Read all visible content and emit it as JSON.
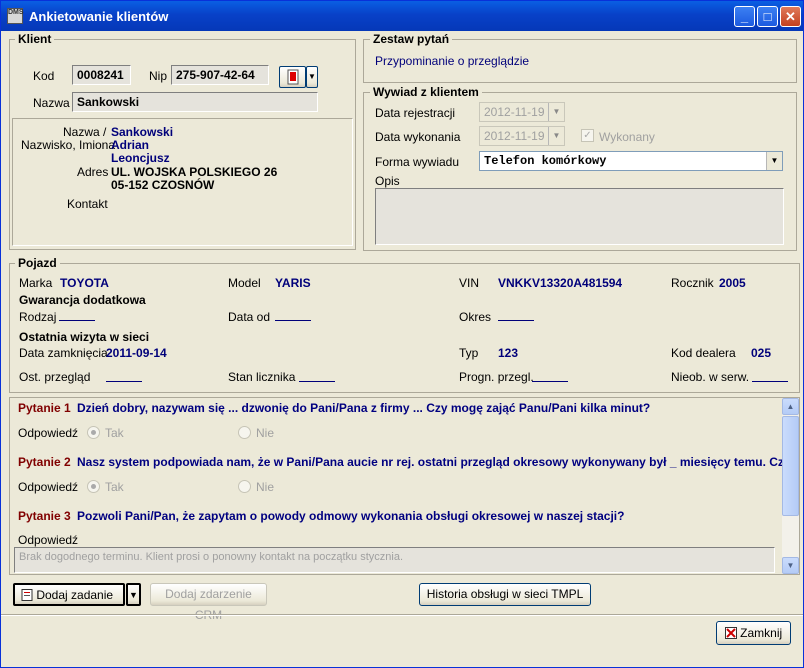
{
  "window": {
    "title": "Ankietowanie klientów",
    "app_icon": "app-badge",
    "min": "_",
    "max": "□",
    "close": "✕"
  },
  "klient": {
    "title": "Klient",
    "kod_label": "Kod",
    "kod_value": "0008241",
    "nip_label": "Nip",
    "nip_value": "275-907-42-64",
    "nazwa_label": "Nazwa",
    "nazwa_value": "Sankowski",
    "nazwa_nazwisko_label1": "Nazwa /",
    "nazwa_nazwisko_label2": "Nazwisko, Imiona",
    "nazwisko_value": "Sankowski",
    "imie1_value": "Adrian",
    "imie2_value": "Leoncjusz",
    "adres_label": "Adres",
    "adres_line1": "UL. WOJSKA POLSKIEGO 26",
    "adres_line2": "05-152 CZOSNÓW",
    "kontakt_label": "Kontakt"
  },
  "zestaw": {
    "title": "Zestaw pytań",
    "value": "Przypominanie o przeglądzie"
  },
  "wywiad": {
    "title": "Wywiad z klientem",
    "data_rej_label": "Data rejestracji",
    "data_rej_value": "2012-11-19",
    "data_wyk_label": "Data wykonania",
    "data_wyk_value": "2012-11-19",
    "wykonany_label": "Wykonany",
    "forma_label": "Forma wywiadu",
    "forma_value": "Telefon komórkowy",
    "opis_label": "Opis"
  },
  "pojazd": {
    "title": "Pojazd",
    "marka_label": "Marka",
    "marka_value": "TOYOTA",
    "model_label": "Model",
    "model_value": "YARIS",
    "vin_label": "VIN",
    "vin_value": "VNKKV13320A481594",
    "rocznik_label": "Rocznik",
    "rocznik_value": "2005",
    "gwarancja_title": "Gwarancja dodatkowa",
    "rodzaj_label": "Rodzaj",
    "data_od_label": "Data od",
    "okres_label": "Okres",
    "wizyta_title": "Ostatnia wizyta w sieci",
    "data_zamk_label": "Data zamknięcia",
    "data_zamk_value": "2011-09-14",
    "typ_label": "Typ",
    "typ_value": "123",
    "kod_dealera_label": "Kod dealera",
    "kod_dealera_value": "025",
    "ost_przeglad_label": "Ost. przegląd",
    "stan_licznika_label": "Stan licznika",
    "progn_label": "Progn. przegl.",
    "nieob_label": "Nieob. w serw."
  },
  "questions": [
    {
      "label": "Pytanie 1",
      "text": "Dzień dobry, nazywam się ... dzwonię do Pani/Pana z firmy ... Czy mogę zająć Panu/Pani kilka minut?",
      "answer_label": "Odpowiedź",
      "yes": "Tak",
      "no": "Nie"
    },
    {
      "label": "Pytanie 2",
      "text": "Nasz system podpowiada nam, że w Pani/Pana aucie nr rej. ostatni przegląd okresowy wykonywany był _ miesięcy temu. Czy",
      "answer_label": "Odpowiedź",
      "yes": "Tak",
      "no": "Nie"
    },
    {
      "label": "Pytanie 3",
      "text": "Pozwoli Pani/Pan, że zapytam o powody odmowy wykonania obsługi okresowej w naszej stacji?",
      "answer_label": "Odpowiedź",
      "answer_text": "Brak dogodnego terminu. Klient prosi o ponowny kontakt na początku stycznia."
    }
  ],
  "buttons": {
    "dodaj_zadanie": "Dodaj zadanie",
    "dodaj_zdarzenie": "Dodaj zdarzenie CRM",
    "historia": "Historia obsługi w sieci TMPL",
    "zamknij": "Zamknij"
  }
}
